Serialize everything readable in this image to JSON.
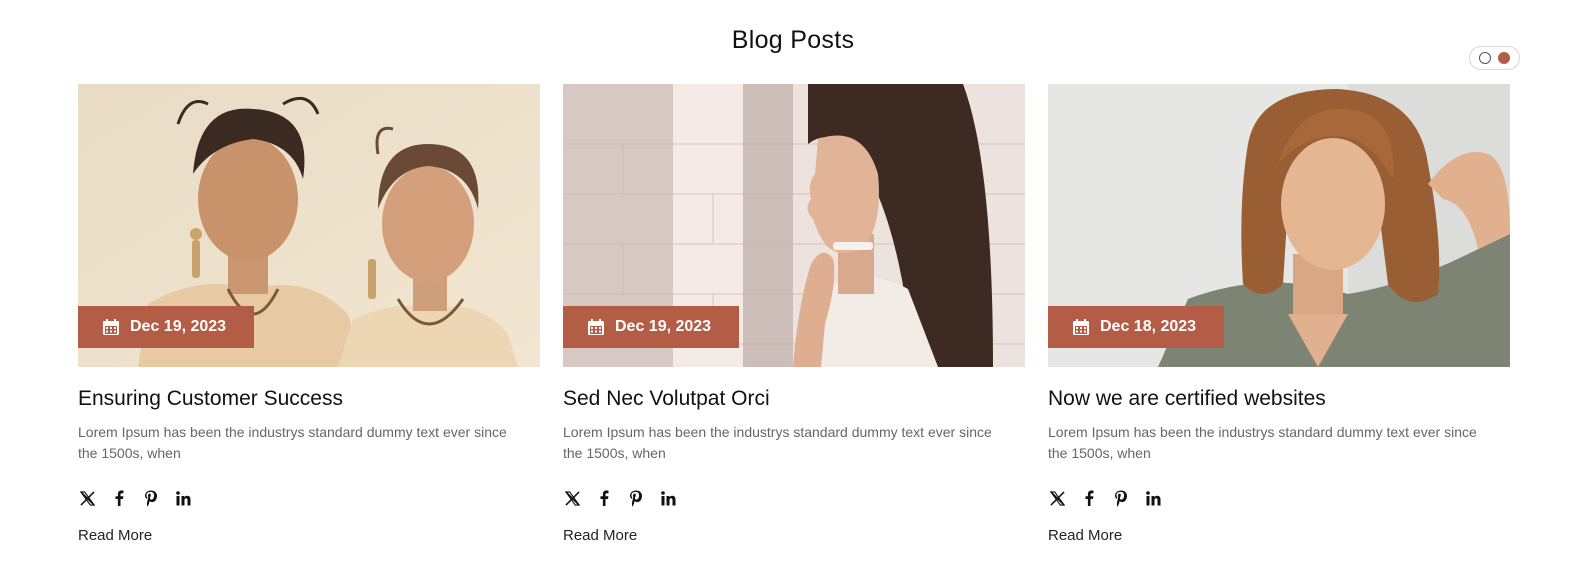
{
  "section": {
    "title": "Blog Posts"
  },
  "pager": {
    "active_index": 1,
    "count": 2
  },
  "posts": [
    {
      "date": "Dec 19, 2023",
      "title": "Ensuring Customer Success",
      "excerpt": "Lorem Ipsum has been the industrys standard dummy text ever since the 1500s, when",
      "read_more": "Read More",
      "image_icon": "two-models-photo"
    },
    {
      "date": "Dec 19, 2023",
      "title": "Sed Nec Volutpat Orci",
      "excerpt": "Lorem Ipsum has been the industrys standard dummy text ever since the 1500s, when",
      "read_more": "Read More",
      "image_icon": "woman-profile-photo"
    },
    {
      "date": "Dec 18, 2023",
      "title": "Now we are certified websites",
      "excerpt": "Lorem Ipsum has been the industrys standard dummy text ever since the 1500s, when",
      "read_more": "Read More",
      "image_icon": "woman-portrait-photo"
    }
  ],
  "social_icons": [
    "x-icon",
    "facebook-icon",
    "pinterest-icon",
    "linkedin-icon"
  ],
  "colors": {
    "accent": "#b45d46",
    "text": "#111111",
    "muted": "#666666"
  }
}
